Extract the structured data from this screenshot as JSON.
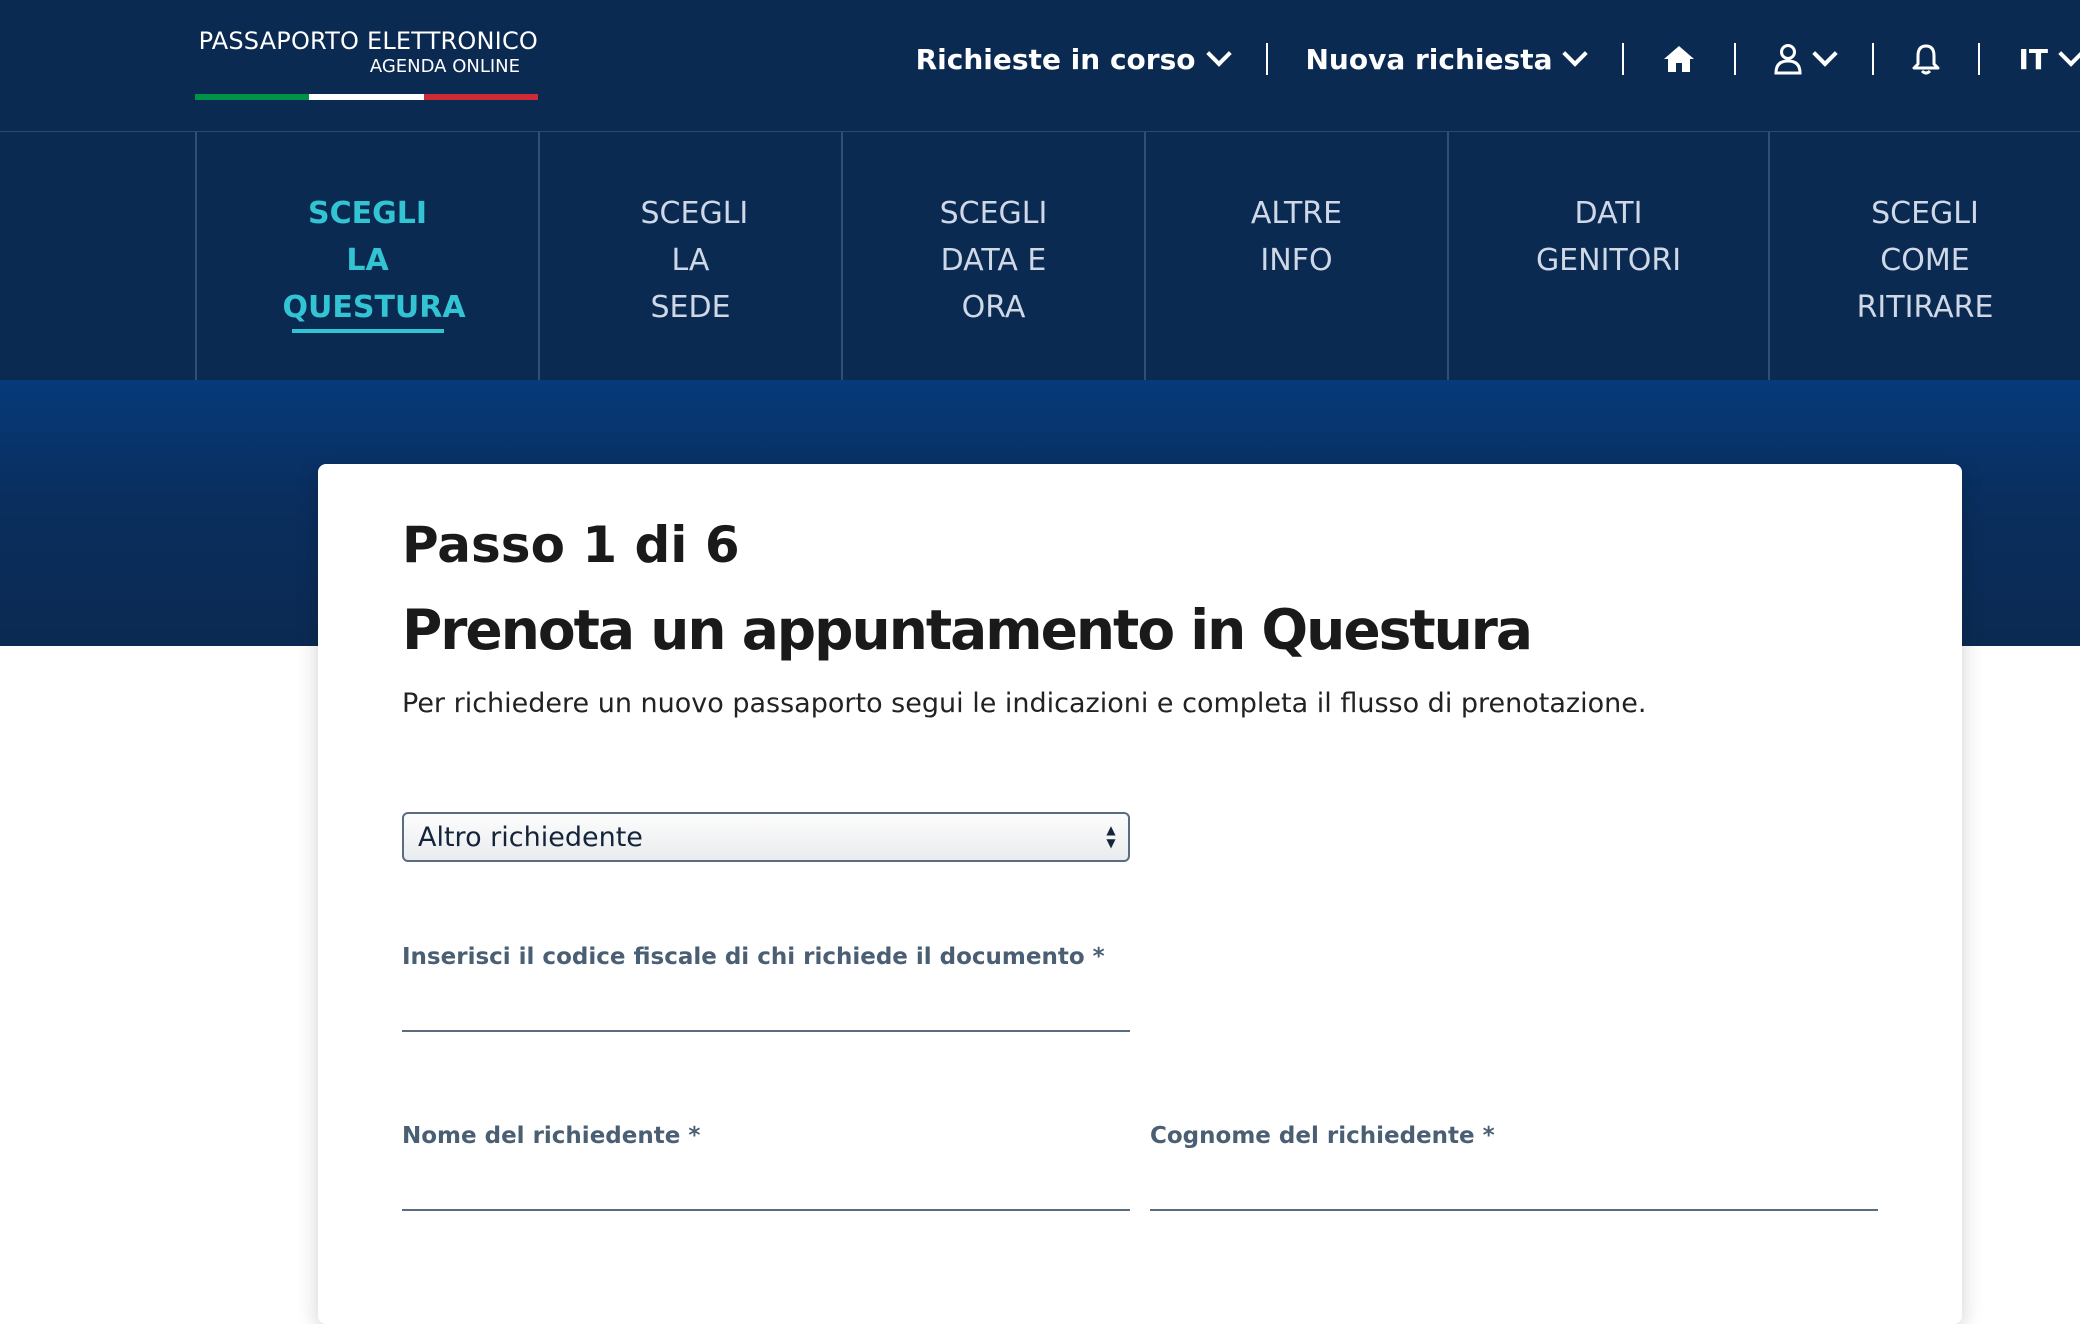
{
  "brand": {
    "title": "PASSAPORTO ELETTRONICO",
    "subtitle": "AGENDA ONLINE",
    "flag_colors": [
      "#009246",
      "#ffffff",
      "#ce2b37"
    ]
  },
  "topnav": {
    "requests_in_progress": "Richieste in corso",
    "new_request": "Nuova richiesta",
    "home_icon": "home-icon",
    "user_icon": "user-icon",
    "bell_icon": "bell-icon",
    "language": "IT"
  },
  "steps": [
    {
      "label": "SCEGLI LA QUESTURA",
      "active": true
    },
    {
      "label": "SCEGLI LA SEDE",
      "active": false
    },
    {
      "label": "SCEGLI DATA E ORA",
      "active": false
    },
    {
      "label": "ALTRE INFO",
      "active": false
    },
    {
      "label": "DATI GENITORI",
      "active": false
    },
    {
      "label": "SCEGLI COME RITIRARE",
      "active": false
    }
  ],
  "form": {
    "step_count": "Passo 1 di 6",
    "title": "Prenota un appuntamento in Questura",
    "intro": "Per richiedere un nuovo passaporto segui le indicazioni e completa il flusso di prenotazione.",
    "applicant_select": "Altro richiedente",
    "tax_code_label": "Inserisci il codice fiscale di chi richiede il documento *",
    "tax_code_value": "",
    "first_name_label": "Nome del richiedente *",
    "first_name_value": "",
    "last_name_label": "Cognome del richiedente *",
    "last_name_value": ""
  },
  "colors": {
    "navy": "#0b2a52",
    "accent": "#33c4d4"
  }
}
